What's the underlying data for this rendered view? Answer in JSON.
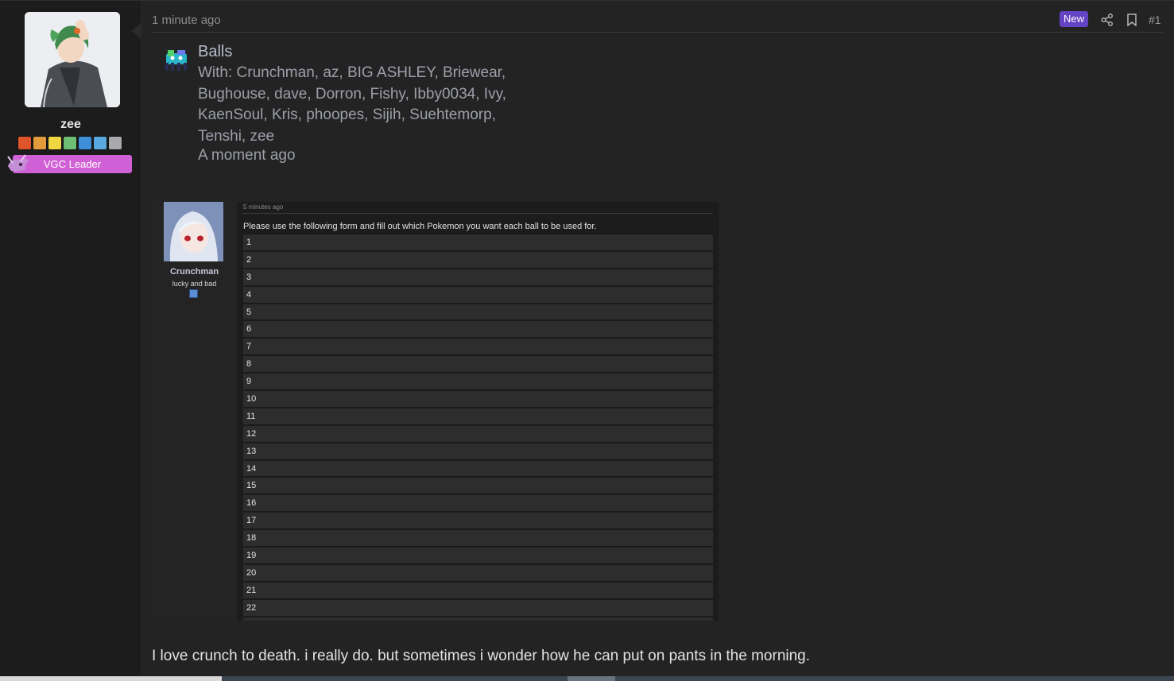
{
  "post": {
    "time": "1 minute ago",
    "new_label": "New",
    "number": "#1",
    "text": "I love crunch to death. i really do. but sometimes i wonder how he can put on pants in the morning."
  },
  "author": {
    "name": "zee",
    "banner": "VGC Leader",
    "banner_color": "#d060d6",
    "badge_icons": [
      "fire-badge",
      "diamond-badge",
      "triangle-badge",
      "crystal-badge",
      "water-badge",
      "shield-badge",
      "moon-badge"
    ]
  },
  "achievement": {
    "title": "Balls",
    "with_text": "With: Crunchman, az, BIG ASHLEY, Briewear, Bughouse, dave, Dorron, Fishy, Ibby0034, Ivy, KaenSoul, Kris, phoopes, Sijih, Suehtemorp, Tenshi, zee",
    "time": "A moment ago"
  },
  "embed": {
    "username": "Crunchman",
    "user_title": "lucky and bad",
    "time": "5 minutes ago",
    "text": "Please use the following form and fill out which Pokemon you want each ball to be used for.",
    "rows": [
      "1",
      "2",
      "3",
      "4",
      "5",
      "6",
      "7",
      "8",
      "9",
      "10",
      "11",
      "12",
      "13",
      "14",
      "15",
      "16",
      "17",
      "18",
      "19",
      "20",
      "21",
      "22"
    ]
  },
  "colors": {
    "background": "#232324",
    "new_badge": "#6443c4"
  }
}
